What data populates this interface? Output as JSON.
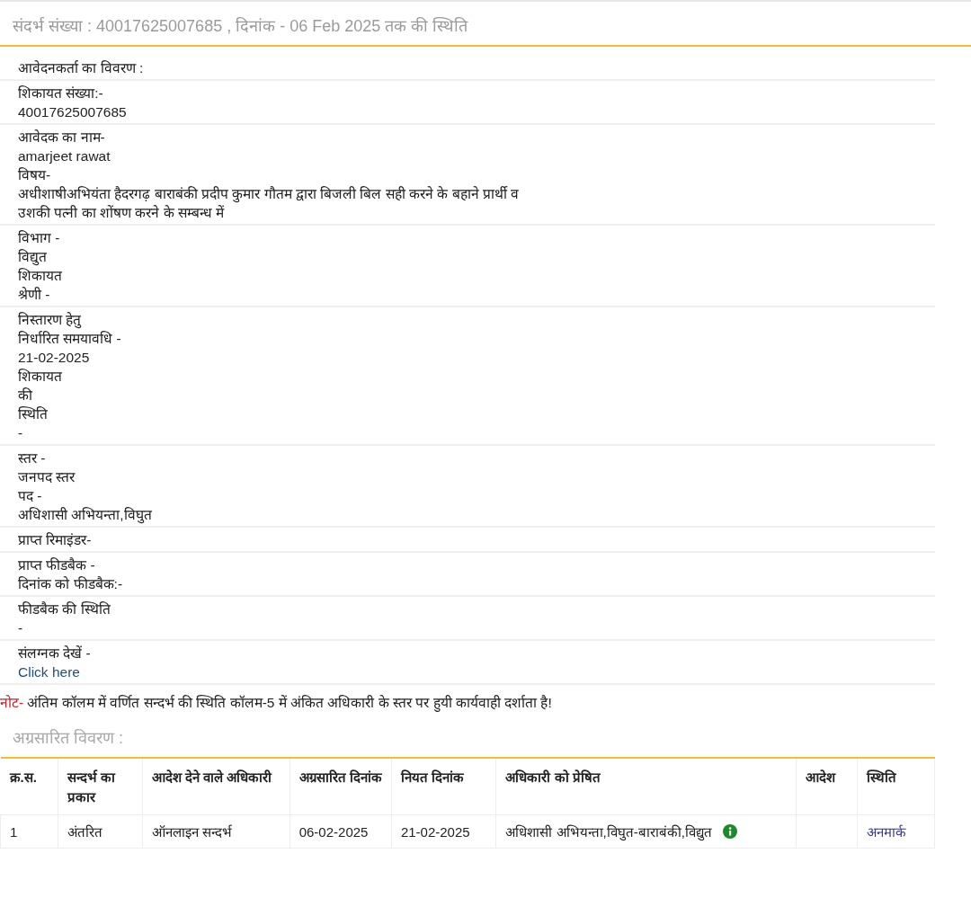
{
  "header": {
    "title": "संदर्भ संख्या : 40017625007685 , दिनांक - 06 Feb 2025 तक की स्थिति"
  },
  "details": {
    "heading": "आवेदनकर्ता का विवरण :",
    "blocks": [
      {
        "lines": [
          {
            "kind": "text",
            "text": "शिकायत संख्या:-"
          },
          {
            "kind": "text",
            "text": "40017625007685"
          }
        ]
      },
      {
        "lines": [
          {
            "kind": "text",
            "text": "आवेदक का नाम-"
          },
          {
            "kind": "text",
            "text": "amarjeet rawat"
          },
          {
            "kind": "text",
            "text": "विषय-"
          },
          {
            "kind": "para",
            "text": "अधीशाषीअभियंता हैदरगढ़ बाराबंकी प्रदीप कुमार गौतम द्वारा बिजली बिल सही करने के बहाने प्रार्थी व उशकी पत्नी का शोंषण करने के सम्बन्ध में"
          }
        ]
      },
      {
        "lines": [
          {
            "kind": "text",
            "text": "विभाग -"
          },
          {
            "kind": "text",
            "text": "विद्युत"
          },
          {
            "kind": "text",
            "text": "शिकायत"
          },
          {
            "kind": "text",
            "text": "श्रेणी -"
          }
        ]
      },
      {
        "lines": [
          {
            "kind": "text",
            "text": "निस्तारण हेतु"
          },
          {
            "kind": "text",
            "text": "निर्धारित समयावधि -"
          },
          {
            "kind": "text",
            "text": "21-02-2025"
          },
          {
            "kind": "text",
            "text": "शिकायत"
          },
          {
            "kind": "text",
            "text": "की"
          },
          {
            "kind": "text",
            "text": "स्थिति"
          },
          {
            "kind": "text",
            "text": "-"
          }
        ]
      },
      {
        "lines": [
          {
            "kind": "text",
            "text": "स्तर -"
          },
          {
            "kind": "text",
            "text": "जनपद स्तर"
          },
          {
            "kind": "text",
            "text": "पद -"
          },
          {
            "kind": "text",
            "text": "अधिशासी अभियन्ता,विघुत"
          }
        ]
      },
      {
        "lines": [
          {
            "kind": "text",
            "text": "प्राप्त रिमाइंडर-"
          }
        ]
      },
      {
        "lines": [
          {
            "kind": "text",
            "text": "प्राप्त फीडबैक -"
          },
          {
            "kind": "text",
            "text": "दिनांक को फीडबैक:-"
          }
        ]
      },
      {
        "lines": [
          {
            "kind": "text",
            "text": "फीडबैक की स्थिति"
          },
          {
            "kind": "text",
            "text": "-"
          }
        ]
      },
      {
        "lines": [
          {
            "kind": "text",
            "text": "संलग्नक देखें -"
          },
          {
            "kind": "link",
            "text": "Click here"
          }
        ]
      }
    ]
  },
  "note": {
    "label": "नोट-",
    "text": "अंतिम कॉलम में वर्णित सन्दर्भ की स्थिति कॉलम-5 में अंकित अधिकारी के स्तर पर हुयी कार्यवाही दर्शाता है!"
  },
  "forwarded": {
    "heading": "अग्रसारित विवरण :",
    "columns": [
      "क्र.स.",
      "सन्दर्भ का प्रकार",
      "आदेश देने वाले अधिकारी",
      "अग्रसारित दिनांक",
      "नियत दिनांक",
      "अधिकारी को प्रेषित",
      "आदेश",
      "स्थिति"
    ],
    "rows": [
      {
        "cells": [
          "1",
          "अंतरित",
          "ऑनलाइन सन्दर्भ",
          "06-02-2025",
          "21-02-2025",
          "अधिशासी अभियन्ता,विघुत-बाराबंकी,विद्युत",
          "",
          "अनमार्क"
        ]
      }
    ]
  }
}
